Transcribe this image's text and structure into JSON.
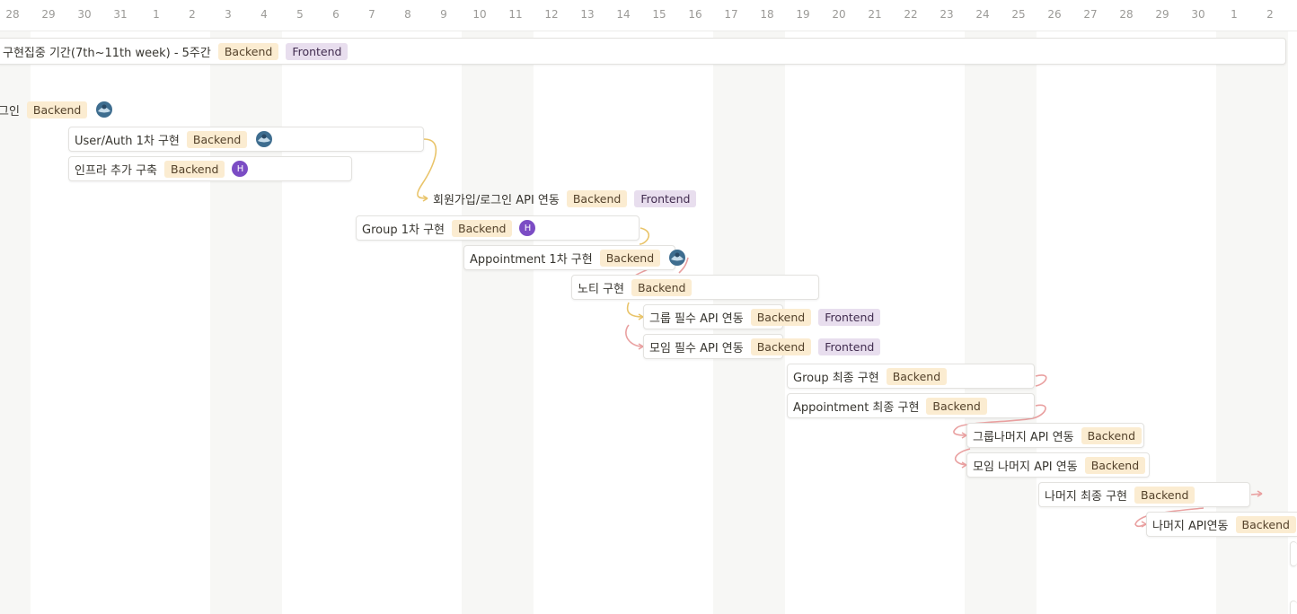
{
  "days": [
    "28",
    "29",
    "30",
    "31",
    "1",
    "2",
    "3",
    "4",
    "5",
    "6",
    "7",
    "8",
    "9",
    "10",
    "11",
    "12",
    "13",
    "14",
    "15",
    "16",
    "17",
    "18",
    "19",
    "20",
    "21",
    "22",
    "23",
    "24",
    "25",
    "26",
    "27",
    "28",
    "29",
    "30",
    "1",
    "2"
  ],
  "tags": {
    "backend": "Backend",
    "frontend": "Frontend"
  },
  "avatar_initial": "H",
  "tasks": [
    {
      "title": "구현집중 기간(7th~11th week) - 5주간"
    },
    {
      "title": "그인"
    },
    {
      "title": "User/Auth 1차 구현"
    },
    {
      "title": "인프라 추가 구축"
    },
    {
      "title": "회원가입/로그인 API 연동"
    },
    {
      "title": "Group 1차 구현"
    },
    {
      "title": "Appointment 1차 구현"
    },
    {
      "title": "노티 구현"
    },
    {
      "title": "그룹 필수 API 연동"
    },
    {
      "title": "모임 필수 API 연동"
    },
    {
      "title": "Group 최종 구현"
    },
    {
      "title": "Appointment 최종 구현"
    },
    {
      "title": "그룹나머지 API 연동"
    },
    {
      "title": "모임 나머지 API 연동"
    },
    {
      "title": "나머지 최종 구현"
    },
    {
      "title": "나머지 API연동"
    }
  ],
  "colors": {
    "backend_bg": "#fbecd1",
    "frontend_bg": "#e8deee",
    "connector_yellow": "#e9c46a",
    "connector_pink": "#e9a0a0",
    "avatar_purple": "#7b4cc4",
    "weekend_bg": "#f7f7f5"
  }
}
